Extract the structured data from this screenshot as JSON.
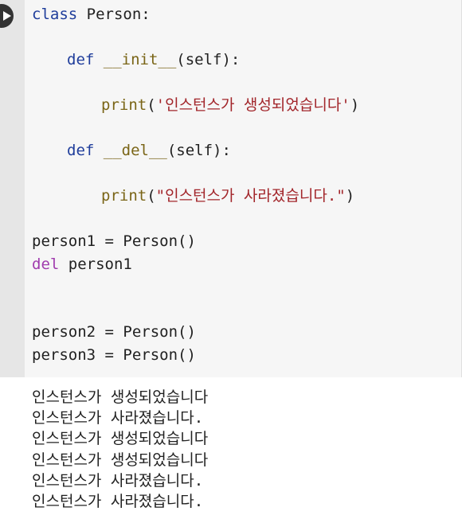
{
  "cell": {
    "run_button_icon": "play-icon"
  },
  "code": {
    "line1": {
      "kw": "class",
      "name": "Person:"
    },
    "line2": {
      "kw": "def",
      "fn": "__init__",
      "args": "(self):"
    },
    "line3": {
      "fn": "print",
      "open": "(",
      "str": "'인스턴스가 생성되었습니다'",
      "close": ")"
    },
    "line4": {
      "kw": "def",
      "fn": "__del__",
      "args": "(self):"
    },
    "line5": {
      "fn": "print",
      "open": "(",
      "str": "\"인스턴스가 사라졌습니다.\"",
      "close": ")"
    },
    "line6": "person1 = Person()",
    "line7": {
      "kw": "del",
      "rest": "person1"
    },
    "line8": "person2 = Person()",
    "line9": "person3 = Person()"
  },
  "output": {
    "lines": [
      "인스턴스가 생성되었습니다",
      "인스턴스가 사라졌습니다.",
      "인스턴스가 생성되었습니다",
      "인스턴스가 생성되었습니다",
      "인스턴스가 사라졌습니다.",
      "인스턴스가 사라졌습니다."
    ]
  }
}
